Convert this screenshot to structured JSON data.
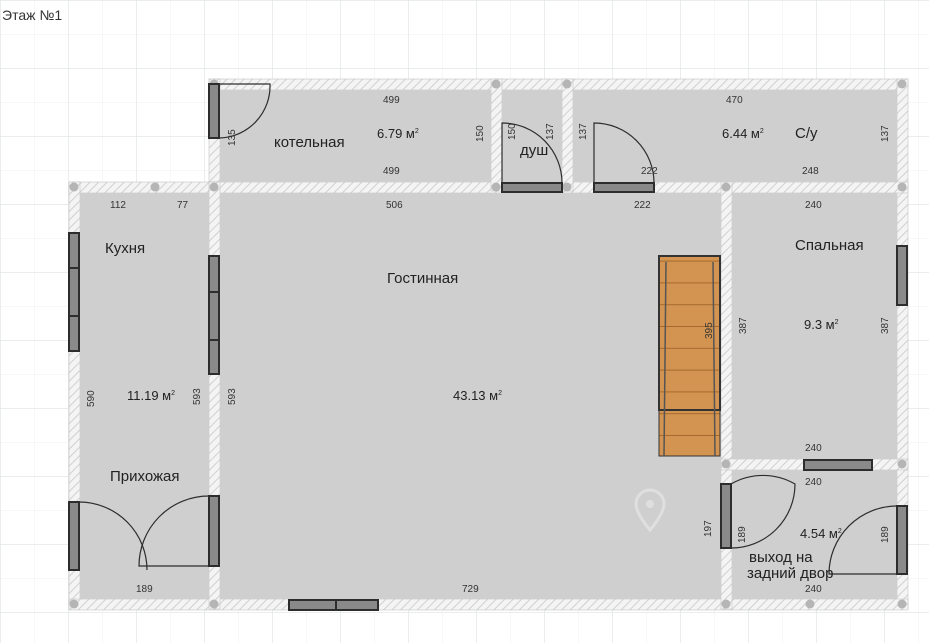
{
  "floor_title": "Этаж №1",
  "rooms": {
    "boiler": {
      "label": "котельная",
      "area": "6.79 м",
      "area_unit_sup": "2"
    },
    "shower": {
      "label": "душ"
    },
    "wc": {
      "label": "С/у",
      "area": "6.44 м",
      "area_unit_sup": "2"
    },
    "kitchen": {
      "label": "Кухня",
      "area": "11.19 м",
      "area_unit_sup": "2"
    },
    "hall": {
      "label": "Прихожая"
    },
    "living": {
      "label": "Гостинная",
      "area": "43.13 м",
      "area_unit_sup": "2"
    },
    "bedroom": {
      "label": "Спальная",
      "area": "9.3 м",
      "area_unit_sup": "2"
    },
    "back_exit": {
      "label_line1": "выход на",
      "label_line2": "задний двор",
      "area": "4.54 м",
      "area_unit_sup": "2"
    }
  },
  "dimensions": {
    "boiler_top": "499",
    "boiler_bottom": "499",
    "boiler_left": "135",
    "boiler_right": "150",
    "shower_left": "150",
    "shower_right": "137",
    "wc_top": "470",
    "wc_left": "137",
    "wc_right": "137",
    "wc_bottom_left": "222",
    "wc_bottom_right": "248",
    "corridor_222": "222",
    "kitchen_top_112": "112",
    "kitchen_top_77": "77",
    "kitchen_left": "590",
    "kitchen_right": "593",
    "living_top": "506",
    "living_left": "593",
    "living_bottom": "729",
    "hall_bottom": "189",
    "stairs": "395",
    "bedroom_top": "240",
    "bedroom_left": "387",
    "bedroom_right": "387",
    "bedroom_bottom": "240",
    "exit_top": "240",
    "exit_left": "197",
    "exit_door_left": "189",
    "exit_right": "189",
    "exit_bottom": "240"
  },
  "colors": {
    "floor": "#cfcfcf",
    "wall_fill": "#f2f2f2",
    "wall_hatch": "#d4d4d4",
    "wall_edge": "#b9b9b9",
    "window": "#2d2d2d",
    "stair_wood": "#d29450",
    "grid": "#e6eaec"
  }
}
